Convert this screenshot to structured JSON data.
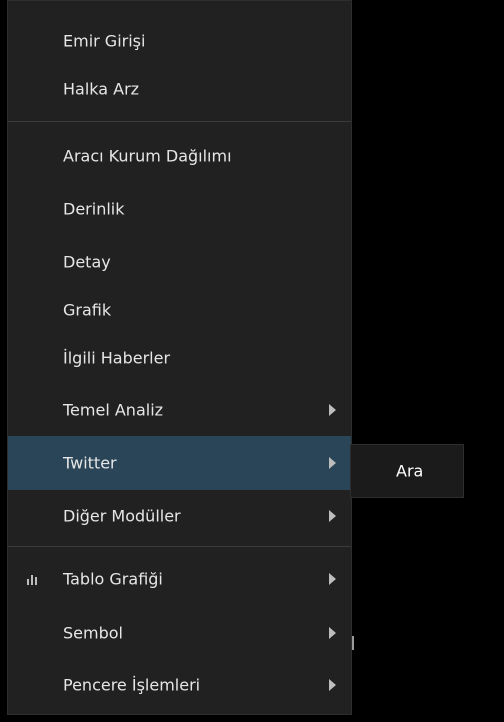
{
  "menu": {
    "group1": [
      {
        "label": "Emir Girişi"
      },
      {
        "label": "Halka Arz"
      }
    ],
    "group2": [
      {
        "label": "Aracı Kurum Dağılımı"
      },
      {
        "label": "Derinlik"
      },
      {
        "label": "Detay"
      },
      {
        "label": "Grafik"
      },
      {
        "label": "İlgili Haberler"
      },
      {
        "label": "Temel Analiz",
        "submenu_icon": "chevron-right-icon"
      },
      {
        "label": "Twitter",
        "submenu_icon": "chevron-right-icon",
        "highlighted": true
      },
      {
        "label": "Diğer Modüller",
        "submenu_icon": "chevron-right-icon"
      }
    ],
    "group3": [
      {
        "label": "Tablo Grafiği",
        "icon": "bar-chart-icon",
        "submenu_icon": "chevron-right-icon"
      },
      {
        "label": "Sembol",
        "submenu_icon": "chevron-right-icon"
      },
      {
        "label": "Pencere İşlemleri",
        "submenu_icon": "chevron-right-icon"
      }
    ]
  },
  "submenu": {
    "items": [
      {
        "label": "Ara"
      }
    ]
  },
  "colors": {
    "menu_bg": "#212121",
    "highlight_bg": "#2a4458",
    "text": "#e6e6e6"
  }
}
